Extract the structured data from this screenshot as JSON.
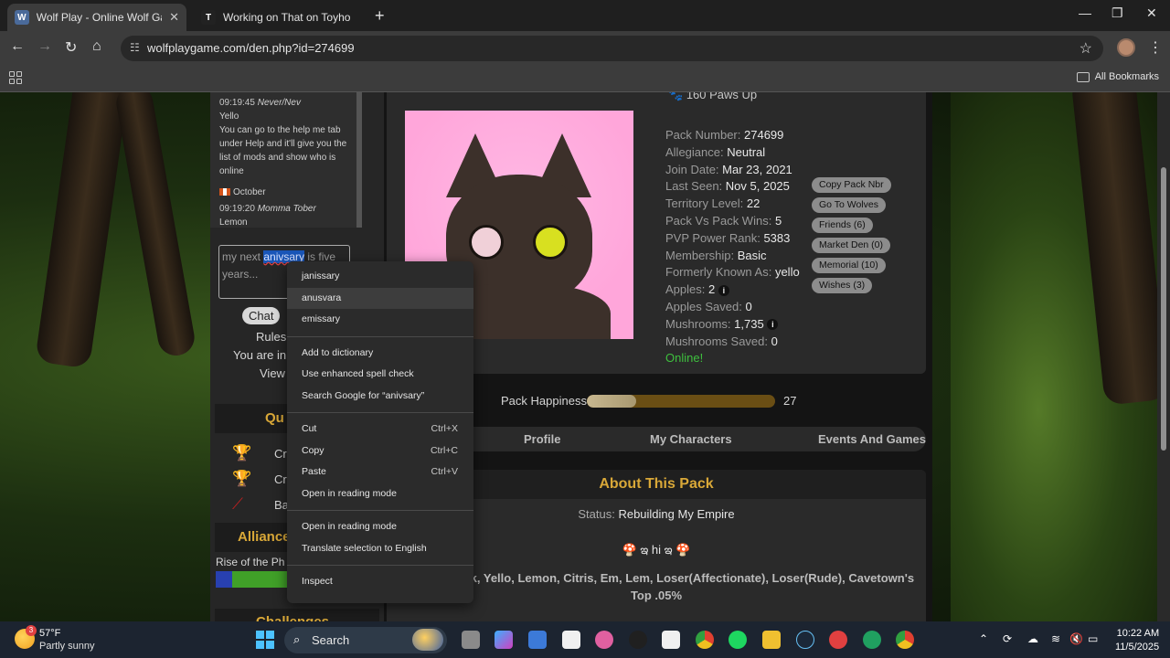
{
  "browser": {
    "tabs": [
      {
        "title": "Wolf Play - Online Wolf Game!",
        "active": true
      },
      {
        "title": "Working on That on Toyhouse",
        "active": false
      }
    ],
    "url": "wolfplaygame.com/den.php?id=274699",
    "bookmarks_label": "All Bookmarks"
  },
  "sidebar": {
    "chat": [
      {
        "time": "09:19:45",
        "name": "Never/Nev",
        "lines": [
          "Yello",
          "You can go to the help me tab under Help and it'll give you the list of mods and show who is online"
        ]
      },
      {
        "flag_name": "October",
        "time": "09:19:20",
        "name": "Momma Tober",
        "lines": [
          "Lemon"
        ]
      }
    ],
    "input_before": "my next ",
    "input_selected": "anivsary",
    "input_after": " is five years...",
    "chat_button": "Chat",
    "rules": "Rules",
    "you_are_in": "You are in:",
    "view": "View",
    "quick_header": "Qu",
    "quick_items": [
      "Cr",
      "Cr",
      "Ba"
    ],
    "alliance_header": "Alliance",
    "rise": "Rise of the Ph",
    "challenges_header": "Challenges"
  },
  "profile": {
    "paws": "160 Paws Up",
    "stats": [
      {
        "label": "Pack Number:",
        "value": "274699"
      },
      {
        "label": "Allegiance:",
        "value": "Neutral"
      },
      {
        "label": "Join Date:",
        "value": "Mar 23, 2021"
      },
      {
        "label": "Last Seen:",
        "value": "Nov 5, 2025"
      },
      {
        "label": "Territory Level:",
        "value": "22"
      },
      {
        "label": "Pack Vs Pack Wins:",
        "value": "5"
      },
      {
        "label": "PVP Power Rank:",
        "value": "5383"
      },
      {
        "label": "Membership:",
        "value": "Basic"
      },
      {
        "label": "Formerly Known As:",
        "value": "yello"
      },
      {
        "label": "Apples:",
        "value": "2"
      },
      {
        "label": "Apples Saved:",
        "value": "0"
      },
      {
        "label": "Mushrooms:",
        "value": "1,735"
      },
      {
        "label": "Mushrooms Saved:",
        "value": "0"
      }
    ],
    "online": "Online!",
    "info_glyph": "i",
    "buttons": [
      "Copy Pack Nbr",
      "Go To Wolves",
      "Friends  (6)",
      "Market Den  (0)",
      "Memorial  (10)",
      "Wishes  (3)"
    ]
  },
  "happiness": {
    "label": "Pack Happiness",
    "value": "27",
    "fill_fraction": 0.26
  },
  "tabs": [
    "Profile",
    "My Characters",
    "Events And Games"
  ],
  "about": {
    "header": "About This Pack",
    "status_label": "Status:",
    "status_value": "Rebuilding My Empire",
    "hi": "🍄 ఇ hi ఇ 🍄",
    "names": "Lemon, Shark, Yello, Lemon, Citris, Em, Lem, Loser(Affectionate), Loser(Rude), Cavetown's Top .05%"
  },
  "context_menu": {
    "suggestions": [
      "janissary",
      "anusvara",
      "emissary"
    ],
    "group2": [
      "Add to dictionary",
      "Use enhanced spell check",
      "Search Google for “anivsary”"
    ],
    "edit": [
      {
        "label": "Cut",
        "shortcut": "Ctrl+X"
      },
      {
        "label": "Copy",
        "shortcut": "Ctrl+C"
      },
      {
        "label": "Paste",
        "shortcut": "Ctrl+V"
      },
      {
        "label": "Open in reading mode",
        "shortcut": ""
      }
    ],
    "group4": [
      "Open in reading mode",
      "Translate selection to English"
    ],
    "inspect": "Inspect"
  },
  "taskbar": {
    "temp": "57°F",
    "weather": "Partly sunny",
    "badge": "3",
    "search": "Search",
    "time": "10:22 AM",
    "date": "11/5/2025"
  }
}
